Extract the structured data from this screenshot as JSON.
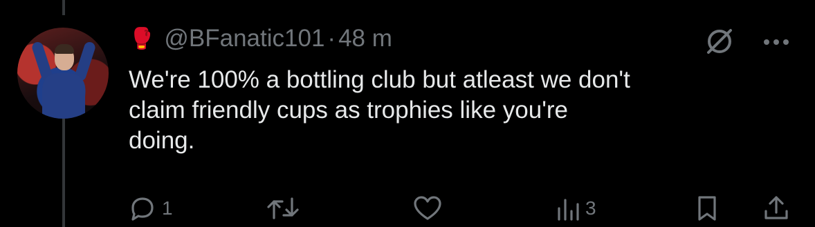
{
  "tweet": {
    "author_emoji": "🥊",
    "handle": "@BFanatic101",
    "separator": "·",
    "time": "48 m",
    "text": "We're 100% a bottling club but atleast we don't\nclaim friendly cups as trophies like you're\ndoing."
  },
  "actions": {
    "reply_count": "1",
    "retweet_count": "",
    "like_count": "",
    "views_count": "3"
  },
  "icons": [
    "grok-icon",
    "more-icon",
    "reply-icon",
    "retweet-icon",
    "like-icon",
    "views-icon",
    "bookmark-icon",
    "share-icon"
  ]
}
